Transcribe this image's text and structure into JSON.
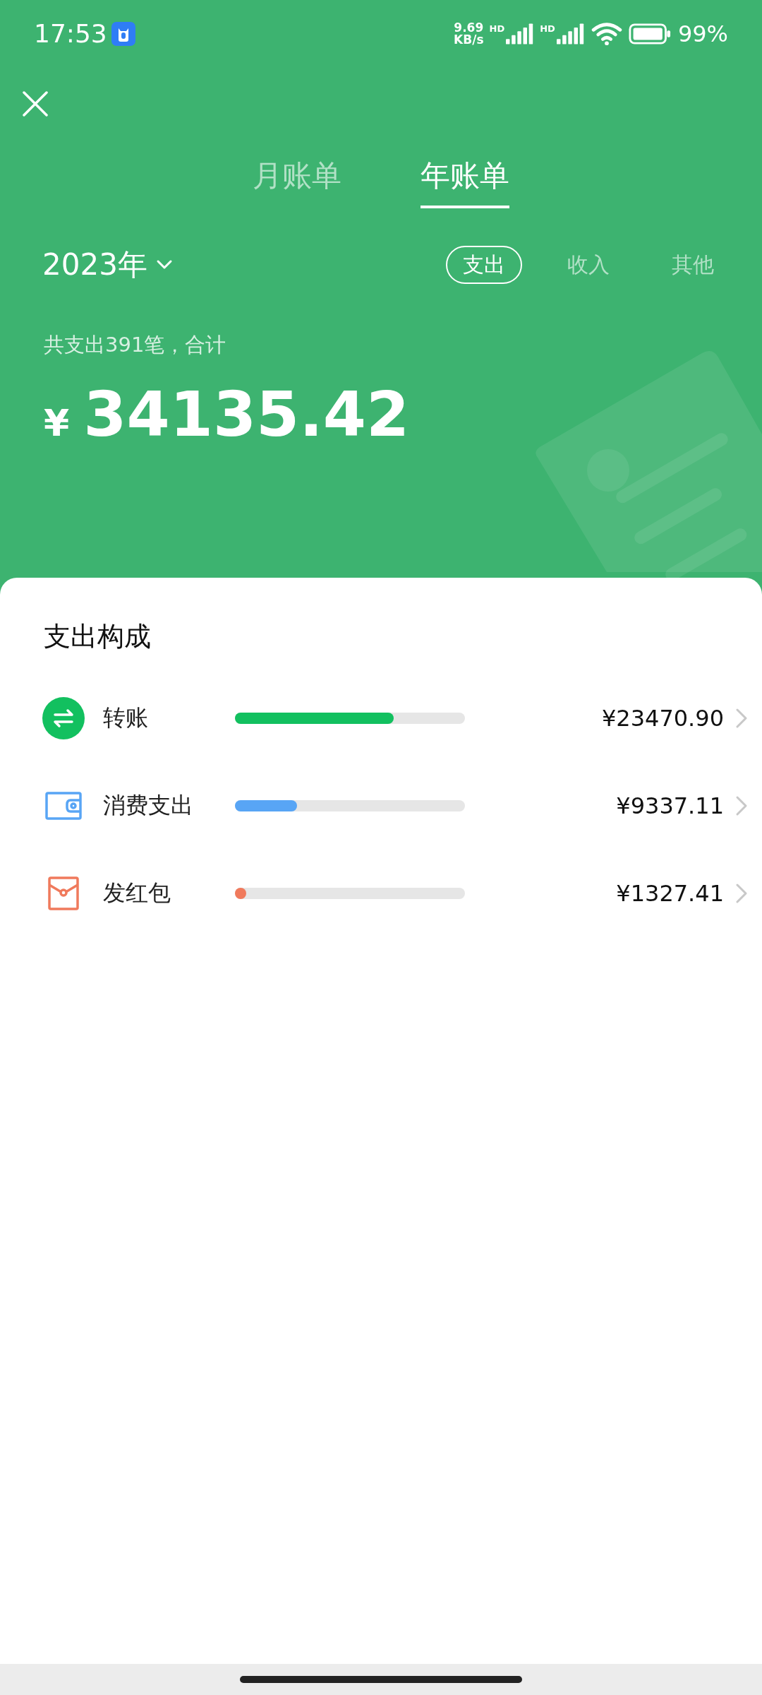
{
  "status_bar": {
    "time": "17:53",
    "net_speed_value": "9.69",
    "net_speed_unit": "KB/s",
    "sim_labels": [
      "HD",
      "HD"
    ],
    "battery": "99%"
  },
  "tabs": [
    {
      "label": "月账单",
      "selected": false
    },
    {
      "label": "年账单",
      "selected": true
    }
  ],
  "year": "2023年",
  "filters": [
    {
      "label": "支出",
      "selected": true
    },
    {
      "label": "收入",
      "selected": false
    },
    {
      "label": "其他",
      "selected": false
    }
  ],
  "summary": {
    "caption": "共支出391笔，合计",
    "currency": "¥",
    "total": "34135.42"
  },
  "breakdown": {
    "title": "支出构成",
    "items": [
      {
        "kind": "transfer",
        "label": "转账",
        "level": 0.69,
        "color": "#12c05f",
        "amount": "¥23470.90"
      },
      {
        "kind": "wallet",
        "label": "消费支出",
        "level": 0.27,
        "color": "#58a5f5",
        "amount": "¥9337.11"
      },
      {
        "kind": "red_packet",
        "label": "发红包",
        "level": 0.039,
        "color": "#f07a5c",
        "amount": "¥1327.41"
      }
    ]
  }
}
